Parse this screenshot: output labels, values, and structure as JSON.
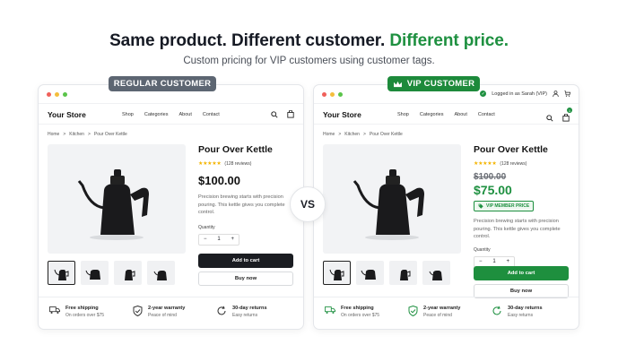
{
  "headline": {
    "part1": "Same product. Different customer. ",
    "part2": "Different price."
  },
  "subline": "Custom pricing for VIP customers using customer tags.",
  "vs": "VS",
  "colors": {
    "accent_green": "#1e9040",
    "regular_pill": "#5d6672",
    "dark_button": "#1b1d22"
  },
  "regular": {
    "pill_label": "REGULAR CUSTOMER",
    "store_name": "Your Store",
    "nav": [
      "Shop",
      "Categories",
      "About",
      "Contact"
    ],
    "breadcrumb": [
      "Home",
      ">",
      "Kitchen",
      ">",
      "Pour Over Kettle"
    ],
    "product_title": "Pour Over Kettle",
    "stars": "★★★★★",
    "reviews": "(128 reviews)",
    "price": "$100.00",
    "description": "Precision brewing starts with precision pouring. This kettle gives you complete control.",
    "quantity_label": "Quantity",
    "quantity": {
      "minus": "−",
      "value": "1",
      "plus": "+"
    },
    "add_to_cart": "Add to cart",
    "buy_now": "Buy now",
    "features": [
      {
        "title": "Free shipping",
        "sub": "On orders over $75",
        "icon": "truck-icon"
      },
      {
        "title": "2-year warranty",
        "sub": "Peace of mind",
        "icon": "shield-check-icon"
      },
      {
        "title": "30-day returns",
        "sub": "Easy returns",
        "icon": "returns-icon"
      }
    ]
  },
  "vip": {
    "pill_label": "VIP CUSTOMER",
    "logged_in": "Logged in as Sarah (VIP)",
    "store_name": "Your Store",
    "nav": [
      "Shop",
      "Categories",
      "About",
      "Contact"
    ],
    "breadcrumb": [
      "Home",
      ">",
      "Kitchen",
      ">",
      "Pour Over Kettle"
    ],
    "product_title": "Pour Over Kettle",
    "stars": "★★★★★",
    "reviews": "(128 reviews)",
    "old_price": "$100.00",
    "price": "$75.00",
    "badge": "VIP MEMBER PRICE",
    "description": "Precision brewing starts with precision pouring. This kettle gives you complete control.",
    "quantity_label": "Quantity",
    "quantity": {
      "minus": "−",
      "value": "1",
      "plus": "+"
    },
    "cart_count": "1",
    "add_to_cart": "Add to cart",
    "buy_now": "Buy now",
    "features": [
      {
        "title": "Free shipping",
        "sub": "On orders over $75",
        "icon": "truck-icon"
      },
      {
        "title": "2-year warranty",
        "sub": "Peace of mind",
        "icon": "shield-check-icon"
      },
      {
        "title": "30-day returns",
        "sub": "Easy returns",
        "icon": "returns-icon"
      }
    ]
  }
}
